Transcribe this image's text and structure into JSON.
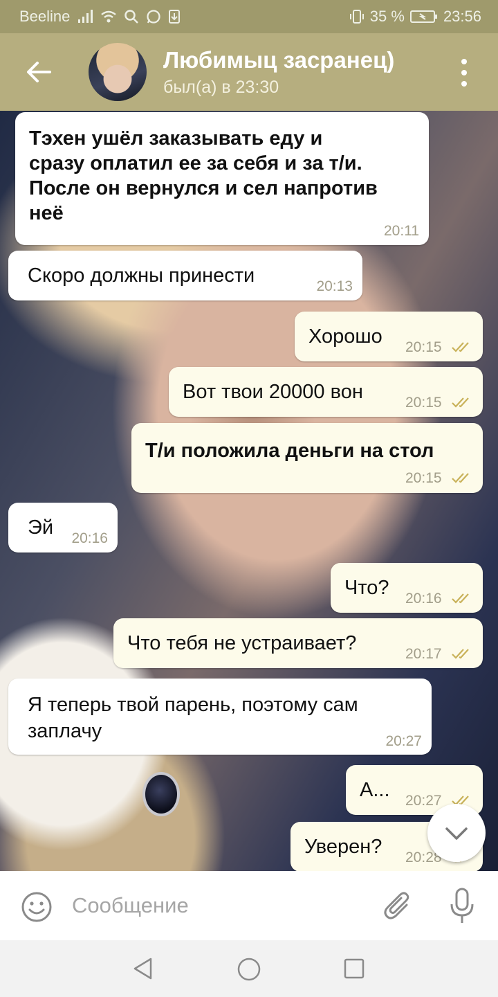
{
  "status_bar": {
    "carrier": "Beeline",
    "battery": "35 %",
    "time": "23:56"
  },
  "header": {
    "contact_name": "Любимыц засранец)",
    "last_seen": "был(а) в 23:30"
  },
  "messages": [
    {
      "dir": "in",
      "lines": [
        "Тэхен ушёл заказывать еду и",
        "сразу оплатил ее за себя и за т/и.",
        "После он вернулся и сел напротив",
        "неё"
      ],
      "time": "20:11",
      "bold": true
    },
    {
      "dir": "in",
      "lines": [
        "Скоро должны принести"
      ],
      "time": "20:13",
      "bold": false
    },
    {
      "dir": "out",
      "lines": [
        "Хорошо"
      ],
      "time": "20:15",
      "bold": false
    },
    {
      "dir": "out",
      "lines": [
        "Вот твои 20000 вон"
      ],
      "time": "20:15",
      "bold": false
    },
    {
      "dir": "out",
      "lines": [
        "Т/и положила деньги на стол"
      ],
      "time": "20:15",
      "bold": true
    },
    {
      "dir": "in",
      "lines": [
        "Эй"
      ],
      "time": "20:16",
      "bold": false
    },
    {
      "dir": "out",
      "lines": [
        "Что?"
      ],
      "time": "20:16",
      "bold": false
    },
    {
      "dir": "out",
      "lines": [
        "Что тебя не устраивает?"
      ],
      "time": "20:17",
      "bold": false
    },
    {
      "dir": "in",
      "lines": [
        "Я теперь твой парень, поэтому сам",
        "заплачу"
      ],
      "time": "20:27",
      "bold": false
    },
    {
      "dir": "out",
      "lines": [
        "А..."
      ],
      "time": "20:27",
      "bold": false
    },
    {
      "dir": "out",
      "lines": [
        "Уверен?"
      ],
      "time": "20:28",
      "bold": false
    }
  ],
  "input": {
    "placeholder": "Сообщение"
  },
  "icons": {
    "back": "arrow-left-icon",
    "menu": "more-vertical-icon",
    "emoji": "smiley-icon",
    "attach": "paperclip-icon",
    "mic": "microphone-icon",
    "scroll_down": "chevron-down-icon",
    "read": "double-check-icon"
  },
  "colors": {
    "header": "#b6ae7f",
    "status_bar": "#9f9a6c",
    "outgoing_bubble": "#fdfbea",
    "incoming_bubble": "#ffffff",
    "tick": "#c9b25a"
  }
}
